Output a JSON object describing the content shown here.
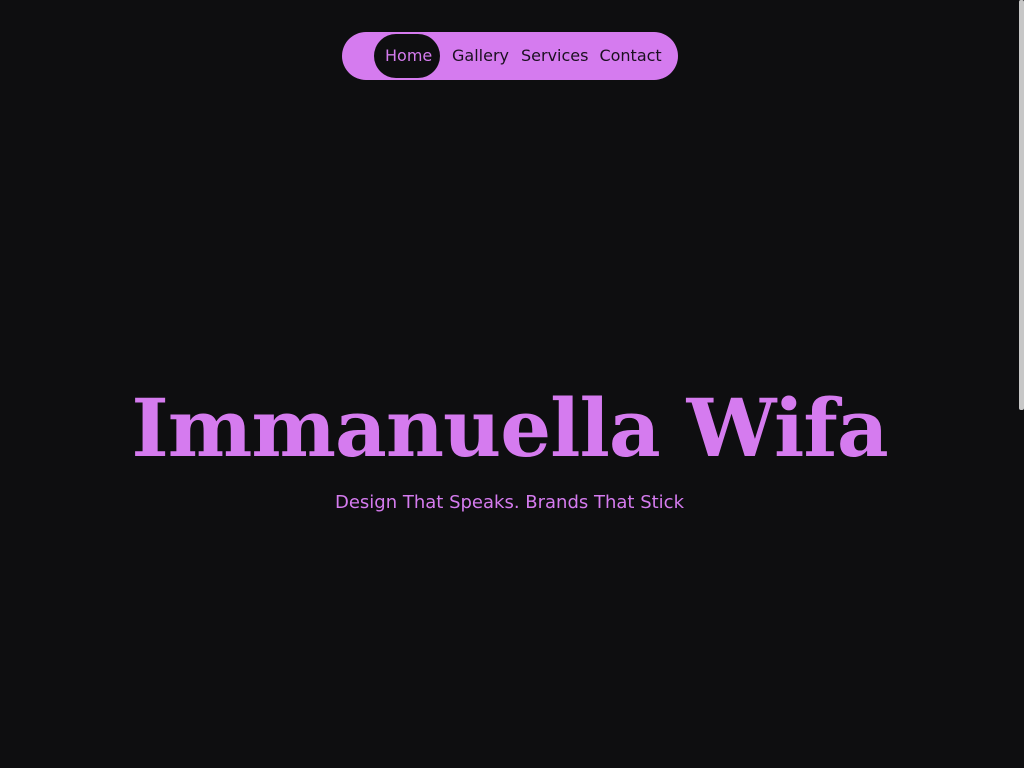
{
  "nav": {
    "items": [
      {
        "label": "Home",
        "active": true
      },
      {
        "label": "Gallery",
        "active": false
      },
      {
        "label": "Services",
        "active": false
      },
      {
        "label": "Contact",
        "active": false
      }
    ]
  },
  "hero": {
    "title": "Immanuella Wifa",
    "subtitle": "Design That Speaks. Brands That Stick"
  },
  "colors": {
    "background": "#0e0e10",
    "accent": "#d57bef",
    "nav_text": "#1b1020"
  }
}
